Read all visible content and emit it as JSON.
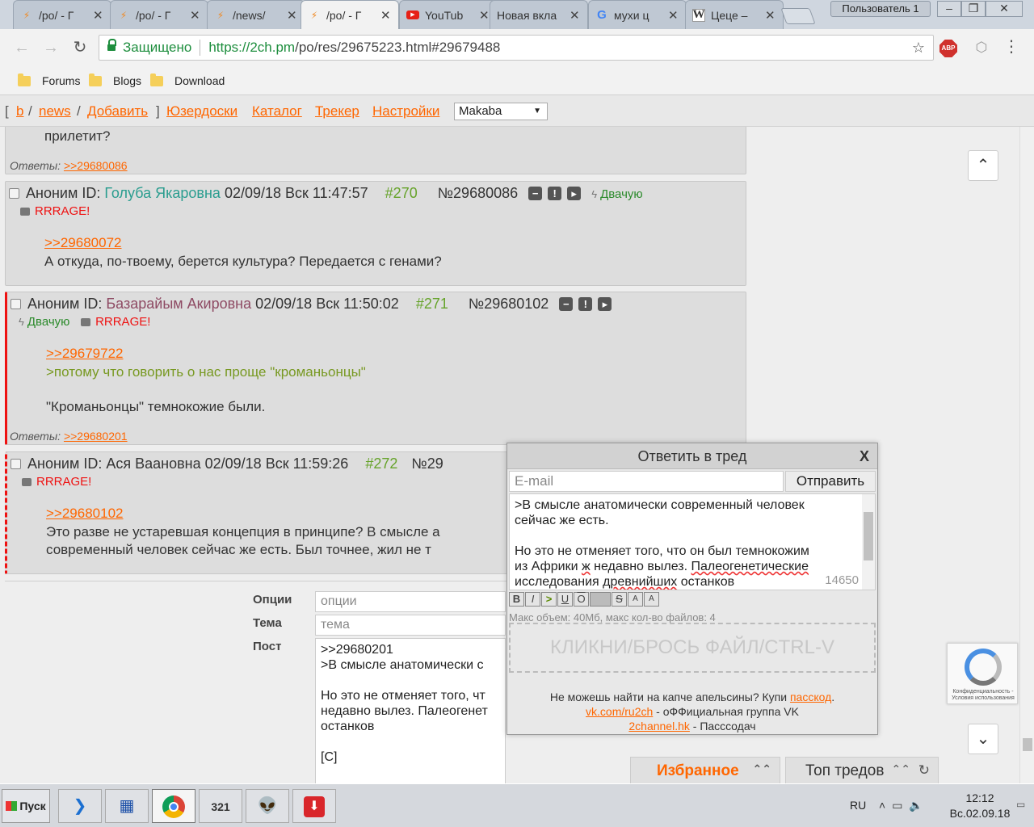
{
  "browser": {
    "tabs": [
      {
        "title": "/po/ - Г",
        "icon": "bolt-icon",
        "active": false
      },
      {
        "title": "/po/ - Г",
        "icon": "bolt-icon",
        "active": false
      },
      {
        "title": "/news/",
        "icon": "bolt-icon",
        "active": false
      },
      {
        "title": "/po/ - Г",
        "icon": "bolt-icon",
        "active": true
      },
      {
        "title": "YouTub",
        "icon": "youtube-icon",
        "active": false
      },
      {
        "title": "Новая вкла",
        "icon": "",
        "active": false
      },
      {
        "title": "мухи ц",
        "icon": "google-icon",
        "active": false
      },
      {
        "title": "Цеце –",
        "icon": "wikipedia-icon",
        "active": false
      }
    ],
    "profile": "Пользователь 1",
    "secure_label": "Защищено",
    "url_host": "https://2ch.pm",
    "url_path": "/po/res/29675223.html#29679488",
    "abp_label": "ABP",
    "bookmarks": [
      "Forums",
      "Blogs",
      "Download"
    ]
  },
  "sitenav": {
    "b": "b",
    "news": "news",
    "add": "Добавить",
    "userboards": "Юзердоски",
    "catalog": "Каталог",
    "tracker": "Трекер",
    "settings": "Настройки",
    "style_select": "Makaba"
  },
  "posts": {
    "prev_tail": "прилетит?",
    "prev_answers_label": "Ответы:",
    "prev_answers_link": ">>29680086",
    "p270": {
      "author": "Аноним ID:",
      "id_name": "Голуба Якаровна",
      "date": "02/09/18 Вск 11:47:57",
      "num": "#270",
      "post_no": "№29680086",
      "dvachu": "Двачую",
      "rrrage": "RRRAGE!",
      "reply_to": ">>29680072",
      "text": "А откуда, по-твоему, берется культура? Передается с генами?"
    },
    "p271": {
      "author": "Аноним ID:",
      "id_name": "Базарайым Акировна",
      "date": "02/09/18 Вск 11:50:02",
      "num": "#271",
      "post_no": "№29680102",
      "dvachu": "Двачую",
      "rrrage": "RRRAGE!",
      "reply_to": ">>29679722",
      "quote": ">потому что говорить о нас проще \"кроманьонцы\"",
      "text": "\"Кроманьонцы\" темнокожие были.",
      "answers_label": "Ответы:",
      "answers_link": ">>29680201"
    },
    "p272": {
      "author": "Аноним ID:",
      "id_name": "Ася Ваановна",
      "date": "02/09/18 Вск 11:59:26",
      "num": "#272",
      "post_no": "№29",
      "rrrage": "RRRAGE!",
      "reply_to": ">>29680102",
      "line1": "Это разве не устаревшая концепция в принципе? В смысле а",
      "line2": "современный человек сейчас же есть. Был точнее, жил не т"
    }
  },
  "form": {
    "options_label": "Опции",
    "options_placeholder": "опции",
    "subject_label": "Тема",
    "subject_placeholder": "тема",
    "post_label": "Пост",
    "post_text": ">>29680201\n>В смысле анатомически с\n\nНо это не отменяет того, чт\nнедавно вылез. Палеогенет\nостанков\n\n[C]"
  },
  "reply_popup": {
    "title": "Ответить в тред",
    "close": "X",
    "email_placeholder": "E-mail",
    "submit": "Отправить",
    "text_line1": ">В смысле анатомически современный человек",
    "text_line2": "сейчас же есть.",
    "text_line3": "Но это не отменяет того, что он был темнокожим",
    "text_line4a": "из Африки ",
    "text_line4b": "ж",
    "text_line4c": " недавно вылез. ",
    "text_line4d": "Палеогенетические",
    "text_line5a": "исследования ",
    "text_line5b": "древнийших",
    "text_line5c": " останков",
    "counter": "14650",
    "limits": "Макс объем: 40Мб, макс кол-во файлов: 4",
    "dropzone": "КЛИКНИ/БРОСЬ ФАЙЛ/CTRL-V",
    "foot1a": "Не можешь найти на капче апельсины? Купи ",
    "foot1b": "пасскод",
    "foot1c": ".",
    "foot2a": "vk.com/ru2ch",
    "foot2b": " - оФФициальная группа VK",
    "foot3a": "2channel.hk",
    "foot3b": " - Пассcодач"
  },
  "bottom_bars": {
    "favorites": "Избранное",
    "top_threads": "Топ тредов"
  },
  "recaptcha": {
    "small_text": "Конфиденциальность - Условия использования"
  },
  "taskbar": {
    "start": "Пуск",
    "lang": "RU",
    "time": "12:12",
    "date": "Вс.02.09.18"
  },
  "colors": {
    "accent_orange": "#ff6600",
    "id_green": "#2a9d8f",
    "id_plum": "#8e4a63",
    "post_num_green": "#66a32a",
    "rrrage_red": "#ee1111",
    "dvachu_green": "#2b8a2b",
    "secure_green": "#1e8e3e"
  }
}
